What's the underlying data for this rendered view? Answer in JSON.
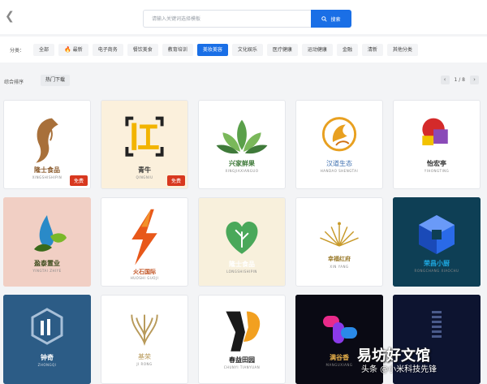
{
  "header": {
    "search_placeholder": "请输入关键词选择模板",
    "search_button": "搜索"
  },
  "categories": {
    "label": "分类：",
    "items": [
      "全部",
      "最新",
      "电子商务",
      "餐饮美食",
      "教育培训",
      "美妆美容",
      "文化娱乐",
      "医疗健康",
      "运动健康",
      "金融",
      "清新",
      "其他分类"
    ],
    "active_index": 5
  },
  "sort": {
    "label": "综合排序",
    "hot_button": "热门下载",
    "page": "1 / 8"
  },
  "cards": [
    {
      "name": "隆士食品",
      "sub": "XINGSHISHIPIN",
      "free": "免费",
      "name_color": "#8a5a2b",
      "bg": "#ffffff"
    },
    {
      "name": "青牛",
      "sub": "QINGNIU",
      "free": "免费",
      "name_color": "#333333",
      "bg": "#fbf0dc"
    },
    {
      "name": "兴家鲜果",
      "sub": "XINGJIAXIANGUO",
      "name_color": "#3f7a3a",
      "bg": "#ffffff"
    },
    {
      "name": "汉道生态",
      "sub": "HANDAO SHENGTAI",
      "name_color": "#3d6fb0",
      "bg": "#ffffff"
    },
    {
      "name": "怡宏亭",
      "sub": "YIHONGTING",
      "name_color": "#333333",
      "bg": "#ffffff"
    },
    {
      "name": "盈泰置业",
      "sub": "YINGTAI ZHIYE",
      "name_color": "#3b4a1a",
      "bg": "#f1cfc4"
    },
    {
      "name": "火石国际",
      "sub": "HUOSHI GUOJI",
      "name_color": "#c0501f",
      "bg": "#ffffff"
    },
    {
      "name": "隆士食品",
      "sub": "LONGSHISHIPIN",
      "name_color": "#ffffff",
      "bg": "#f8f0dc"
    },
    {
      "name": "幸福红府",
      "sub": "XIN YANG",
      "name_color": "#9a7a2a",
      "bg": "#ffffff"
    },
    {
      "name": "荣昌小厨",
      "sub": "RONGCHANG XIAOCHU",
      "name_color": "#1ea8e0",
      "bg": "#0e3f55"
    },
    {
      "name": "钟奇",
      "sub": "ZHONGQI",
      "name_color": "#ffffff",
      "bg": "#2c5c86"
    },
    {
      "name": "基荣",
      "sub": "JI RONG",
      "name_color": "#b89a5a",
      "bg": "#ffffff"
    },
    {
      "name": "春益田园",
      "sub": "CHUNYI TIANYUAN",
      "name_color": "#222222",
      "bg": "#ffffff"
    },
    {
      "name": "满谷香",
      "sub": "MANGUXIANG",
      "name_color": "#e8b04a",
      "bg": "#0a0a14"
    },
    {
      "name": "",
      "sub": "",
      "name_color": "#ffffff",
      "bg": "#0d1430"
    }
  ],
  "watermark": {
    "main": "易坊好文馆",
    "sub": "头条 @小米科技先锋"
  },
  "colors": {
    "accent": "#1a6fe6",
    "free_badge": "#d8381f"
  }
}
